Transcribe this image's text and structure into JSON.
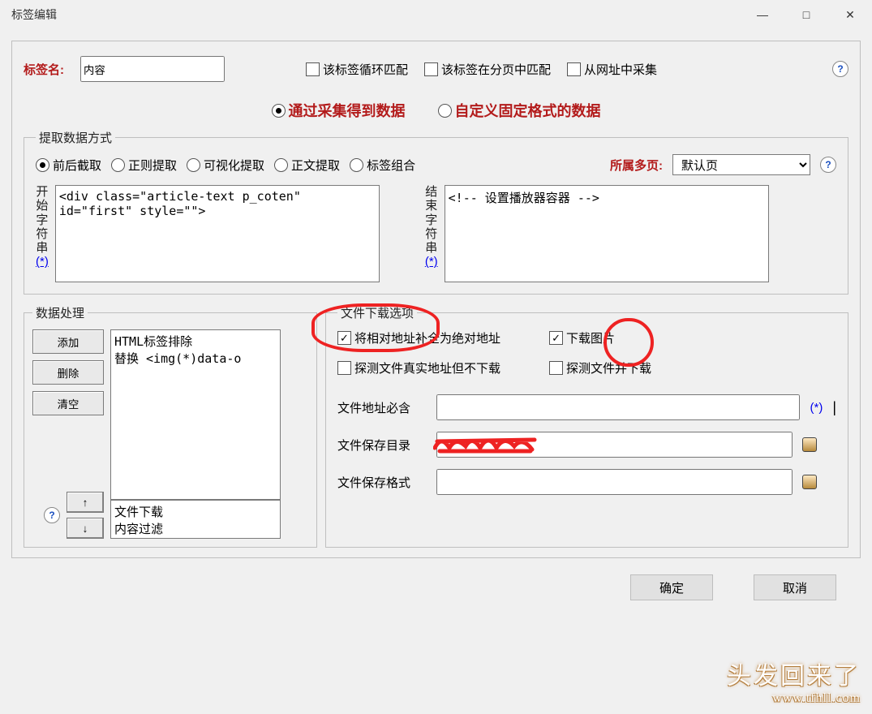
{
  "window_title": "标签编辑",
  "top": {
    "tag_name_label": "标签名:",
    "tag_name_value": "内容",
    "cb_loop": "该标签循环匹配",
    "cb_pagination": "该标签在分页中匹配",
    "cb_from_url": "从网址中采集"
  },
  "mode": {
    "via_collect": "通过采集得到数据",
    "custom_fixed": "自定义固定格式的数据"
  },
  "extract": {
    "legend": "提取数据方式",
    "r_beforeafter": "前后截取",
    "r_regex": "正则提取",
    "r_visual": "可视化提取",
    "r_body": "正文提取",
    "r_combo": "标签组合",
    "owner_label": "所属多页:",
    "owner_value": "默认页",
    "start_label": "开始字符串",
    "end_label": "结束字符串",
    "start_value": "<div class=\"article-text p_coten\" id=\"first\" style=\"\">",
    "end_value": "<!-- 设置播放器容器 -->",
    "link": "(*)"
  },
  "process": {
    "legend": "数据处理",
    "btn_add": "添加",
    "btn_del": "删除",
    "btn_clear": "清空",
    "list_top": "HTML标签排除\n替换 <img(*)data-o",
    "list_bottom": "文件下载\n内容过滤"
  },
  "file": {
    "legend": "文件下载选项",
    "cb_abs": "将相对地址补全为绝对地址",
    "cb_dlimg": "下载图片",
    "cb_probe_no": "探测文件真实地址但不下载",
    "cb_probe_dl": "探测文件并下载",
    "lbl_mustcontain": "文件地址必含",
    "lbl_savedir": "文件保存目录",
    "lbl_savefmt": "文件保存格式",
    "wildcard": "(*)",
    "pipe": "|"
  },
  "footer": {
    "ok": "确定",
    "cancel": "取消"
  },
  "watermark": {
    "a": "头发回来了",
    "b": "www.tfhll.com"
  }
}
